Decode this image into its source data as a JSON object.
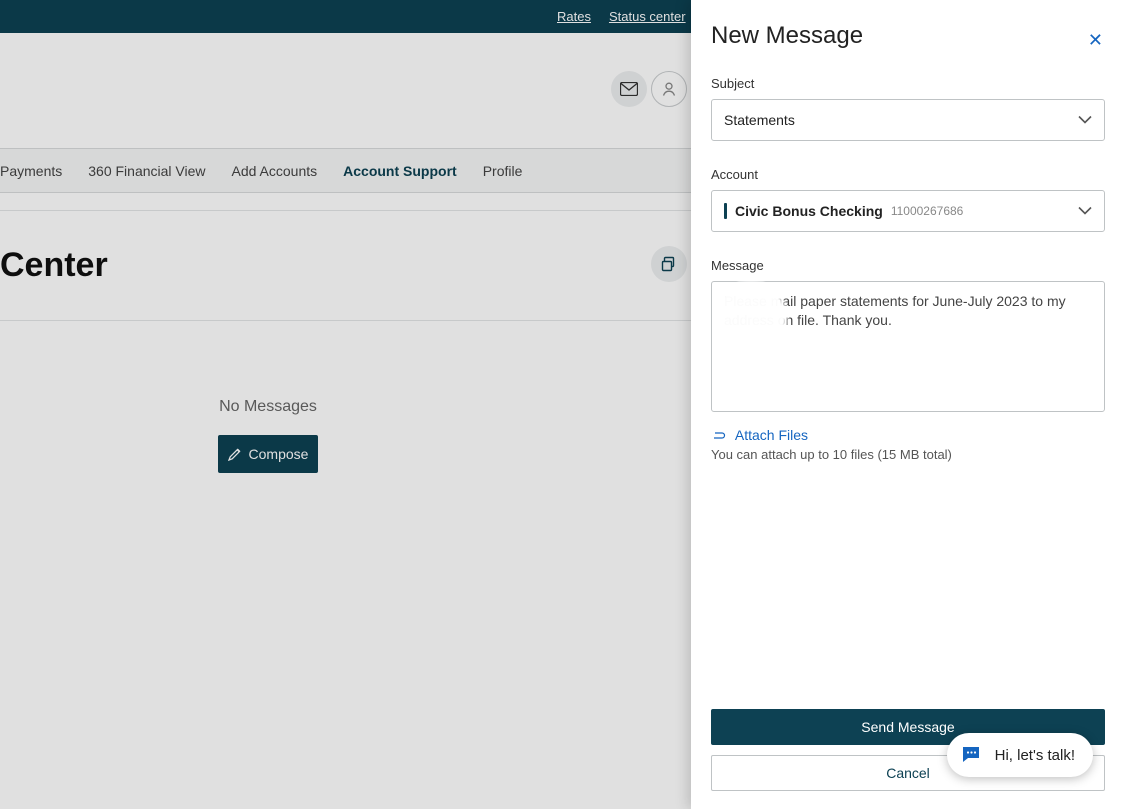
{
  "topnav": {
    "rates": "Rates",
    "status_center": "Status center"
  },
  "nav": {
    "payments": "Payments",
    "financial_view": "360 Financial View",
    "add_accounts": "Add Accounts",
    "account_support": "Account Support",
    "profile": "Profile"
  },
  "page": {
    "title": "Center",
    "no_messages": "No Messages",
    "compose": "Compose"
  },
  "panel": {
    "title": "New Message",
    "subject_label": "Subject",
    "subject_value": "Statements",
    "account_label": "Account",
    "account_name": "Civic Bonus Checking",
    "account_number": "11000267686",
    "message_label": "Message",
    "message_text": "Please mail paper statements for June-July 2023 to my address on file. Thank you.",
    "attach_label": "Attach Files",
    "attach_hint": "You can attach up to 10 files (15 MB total)",
    "send": "Send Message",
    "cancel": "Cancel"
  },
  "chat": {
    "text": "Hi, let's talk!"
  }
}
